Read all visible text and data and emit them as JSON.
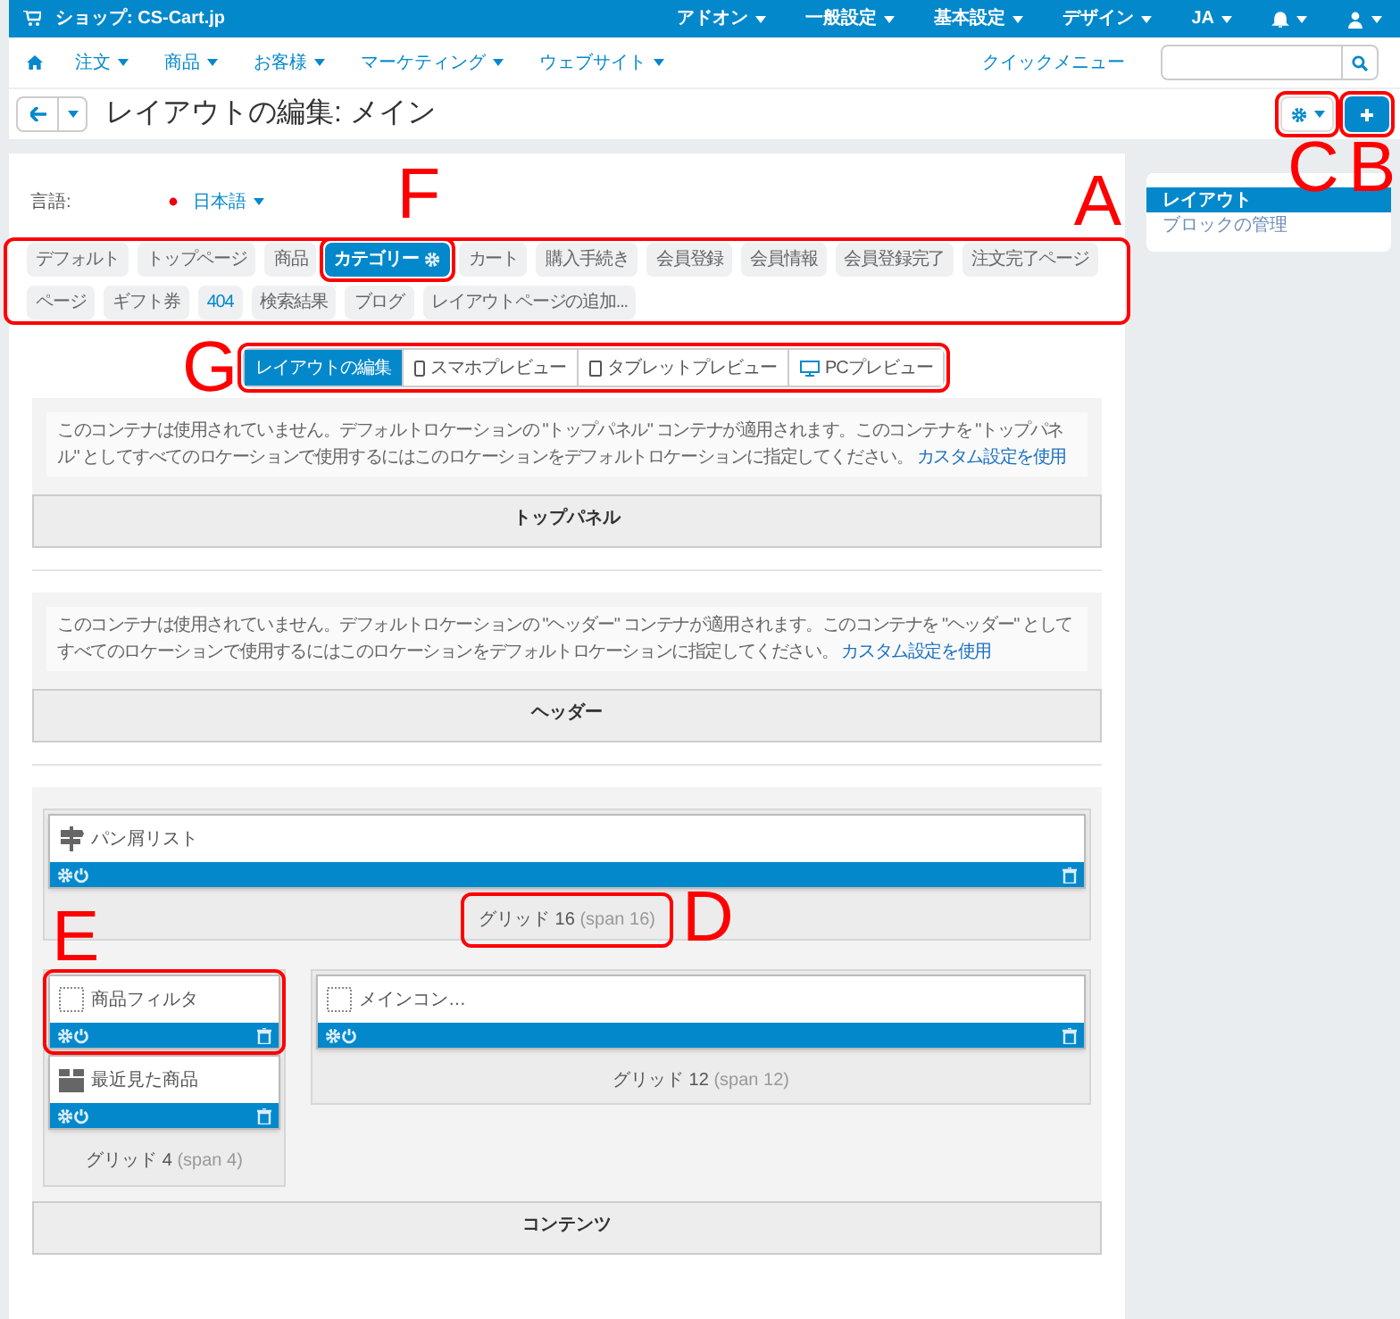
{
  "top_bar": {
    "store": "ショップ: CS-Cart.jp",
    "menus": [
      "アドオン",
      "一般設定",
      "基本設定",
      "デザイン",
      "JA"
    ]
  },
  "nav": {
    "items": [
      "注文",
      "商品",
      "お客様",
      "マーケティング",
      "ウェブサイト"
    ],
    "quick_menu": "クイックメニュー"
  },
  "toolbar": {
    "title": "レイアウトの編集: メイン"
  },
  "language": {
    "label": "言語:",
    "value": "日本語"
  },
  "layout_pages": [
    {
      "label": "デフォルト",
      "kind": "page",
      "selected": false
    },
    {
      "label": "トップページ",
      "kind": "page",
      "selected": false
    },
    {
      "label": "商品",
      "kind": "page",
      "selected": false
    },
    {
      "label": "カテゴリー",
      "kind": "page",
      "selected": true
    },
    {
      "label": "カート",
      "kind": "page",
      "selected": false
    },
    {
      "label": "購入手続き",
      "kind": "page",
      "selected": false
    },
    {
      "label": "会員登録",
      "kind": "page",
      "selected": false
    },
    {
      "label": "会員情報",
      "kind": "page",
      "selected": false
    },
    {
      "label": "会員登録完了",
      "kind": "page",
      "selected": false
    },
    {
      "label": "注文完了ページ",
      "kind": "page",
      "selected": false
    },
    {
      "label": "ページ",
      "kind": "page",
      "selected": false
    },
    {
      "label": "ギフト券",
      "kind": "page",
      "selected": false
    },
    {
      "label": "404",
      "kind": "link",
      "selected": false
    },
    {
      "label": "検索結果",
      "kind": "page",
      "selected": false
    },
    {
      "label": "ブログ",
      "kind": "page",
      "selected": false
    },
    {
      "label": "レイアウトページの追加...",
      "kind": "add",
      "selected": false
    }
  ],
  "view_modes": [
    {
      "label": "レイアウトの編集",
      "kind": "edit",
      "selected": true
    },
    {
      "label": "スマホプレビュー",
      "kind": "phone",
      "selected": false
    },
    {
      "label": "タブレットプレビュー",
      "kind": "tablet",
      "selected": false
    },
    {
      "label": "PCプレビュー",
      "kind": "desktop",
      "selected": false
    }
  ],
  "containers": [
    {
      "kind": "notice",
      "message": "このコンテナは使用されていません。デフォルトロケーションの \"トップパネル\" コンテナが適用されます。このコンテナを \"トップパネル\" としてすべてのロケーションで使用するにはこのロケーションをデフォルトロケーションに指定してください。",
      "link": "カスタム設定を使用",
      "title": "トップパネル"
    },
    {
      "kind": "notice",
      "message": "このコンテナは使用されていません。デフォルトロケーションの \"ヘッダー\" コンテナが適用されます。このコンテナを \"ヘッダー\" としてすべてのロケーションで使用するにはこのロケーションをデフォルトロケーションに指定してください。",
      "link": "カスタム設定を使用",
      "title": "ヘッダー"
    },
    {
      "kind": "grids",
      "title": "コンテンツ",
      "rows": [
        [
          {
            "grid": "グリッド 16",
            "span": "(span 16)",
            "blocks": [
              {
                "name": "パン屑リスト",
                "kind": "breadcrumbs"
              }
            ]
          }
        ],
        [
          {
            "grid": "グリッド 4",
            "span": "(span 4)",
            "blocks": [
              {
                "name": "商品フィルタ",
                "kind": "empty"
              },
              {
                "name": "最近見た商品",
                "kind": "products"
              }
            ]
          },
          {
            "grid": "グリッド 12",
            "span": "(span 12)",
            "blocks": [
              {
                "name": "メインコン…",
                "kind": "empty"
              }
            ]
          }
        ]
      ]
    }
  ],
  "sidebar": {
    "items": [
      {
        "label": "レイアウト",
        "selected": true
      },
      {
        "label": "ブロックの管理",
        "selected": false
      }
    ]
  },
  "annotations": [
    {
      "label": "F"
    },
    {
      "label": "A"
    },
    {
      "label": "C"
    },
    {
      "label": "B"
    },
    {
      "label": "G"
    },
    {
      "label": "D"
    },
    {
      "label": "E"
    }
  ]
}
